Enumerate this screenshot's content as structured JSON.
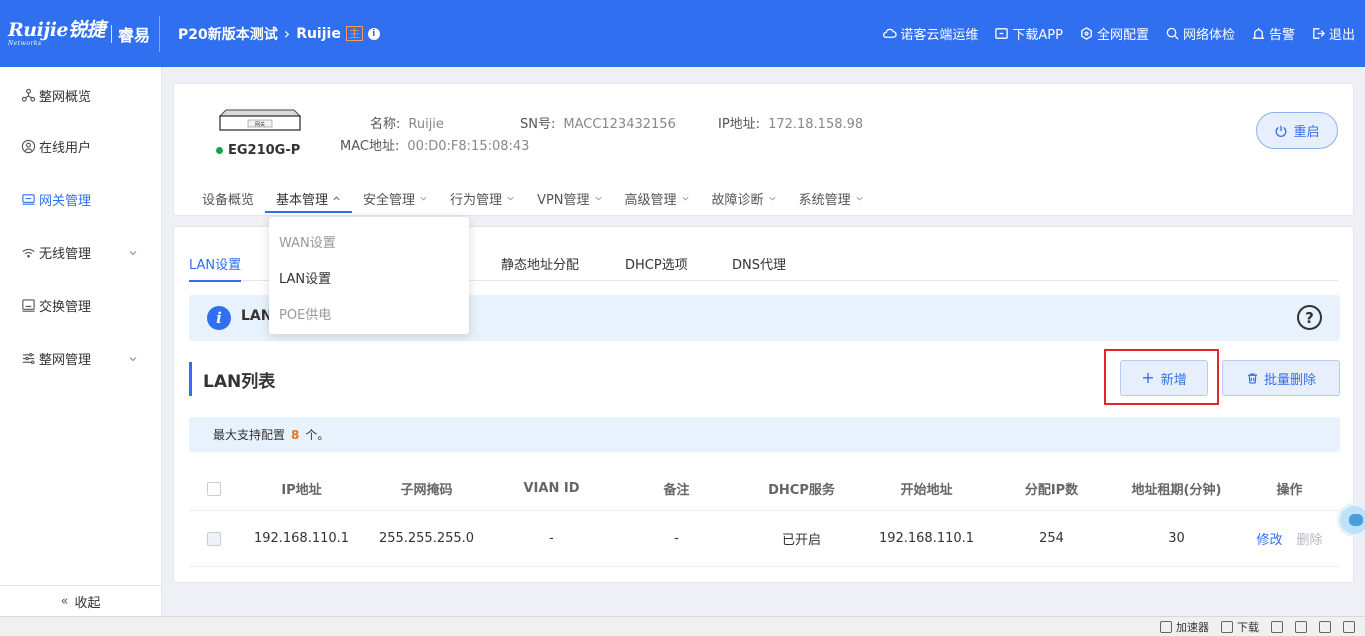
{
  "brand": {
    "logo_text": "Ruijie锐捷",
    "logo_sub": "Networks",
    "product": "睿易"
  },
  "breadcrumb": {
    "project": "P20新版本测试",
    "device": "Ruijie",
    "tag": "主"
  },
  "top_actions": [
    {
      "label": "诺客云端运维",
      "icon": "cloud-icon"
    },
    {
      "label": "下载APP",
      "icon": "app-download-icon"
    },
    {
      "label": "全网配置",
      "icon": "network-config-icon"
    },
    {
      "label": "网络体检",
      "icon": "network-check-icon"
    },
    {
      "label": "告警",
      "icon": "alarm-icon"
    },
    {
      "label": "退出",
      "icon": "logout-icon"
    }
  ],
  "sidebar": {
    "items": [
      {
        "label": "整网概览",
        "icon": "network-overview-icon"
      },
      {
        "label": "在线用户",
        "icon": "user-icon"
      },
      {
        "label": "网关管理",
        "icon": "gateway-icon"
      },
      {
        "label": "无线管理",
        "icon": "wifi-icon"
      },
      {
        "label": "交换管理",
        "icon": "switch-icon"
      },
      {
        "label": "整网管理",
        "icon": "network-manage-icon"
      }
    ],
    "collapse_label": "收起"
  },
  "device": {
    "image_label": "网关",
    "model": "EG210G-P",
    "name_label": "名称:",
    "name_value": "Ruijie",
    "sn_label": "SN号:",
    "sn_value": "MACC123432156",
    "ip_label": "IP地址:",
    "ip_value": "172.18.158.98",
    "mac_label": "MAC地址:",
    "mac_value": "00:D0:F8:15:08:43",
    "reboot_label": "重启",
    "tabs": [
      {
        "label": "设备概览"
      },
      {
        "label": "基本管理"
      },
      {
        "label": "安全管理"
      },
      {
        "label": "行为管理"
      },
      {
        "label": "VPN管理"
      },
      {
        "label": "高级管理"
      },
      {
        "label": "故障诊断"
      },
      {
        "label": "系统管理"
      }
    ]
  },
  "dropdown": {
    "items": [
      {
        "label": "WAN设置"
      },
      {
        "label": "LAN设置"
      },
      {
        "label": "POE供电"
      }
    ]
  },
  "sub_tabs": [
    {
      "label": "LAN设置"
    },
    {
      "label": "静态地址分配"
    },
    {
      "label": "DHCP选项"
    },
    {
      "label": "DNS代理"
    }
  ],
  "info_bar": {
    "text": "LAN"
  },
  "lan_list": {
    "title": "LAN列表",
    "add_label": "新增",
    "batch_delete_label": "批量删除",
    "max_prefix": "最大支持配置",
    "max_count": "8",
    "max_suffix": "个。",
    "columns": [
      "IP地址",
      "子网掩码",
      "VIAN ID",
      "备注",
      "DHCP服务",
      "开始地址",
      "分配IP数",
      "地址租期(分钟)",
      "操作"
    ],
    "rows": [
      {
        "ip": "192.168.110.1",
        "mask": "255.255.255.0",
        "vlan": "-",
        "remark": "-",
        "dhcp": "已开启",
        "start": "192.168.110.1",
        "count": "254",
        "lease": "30",
        "edit_label": "修改",
        "delete_label": "删除"
      }
    ]
  },
  "statusbar": {
    "items": [
      "加速器",
      "下载"
    ]
  }
}
